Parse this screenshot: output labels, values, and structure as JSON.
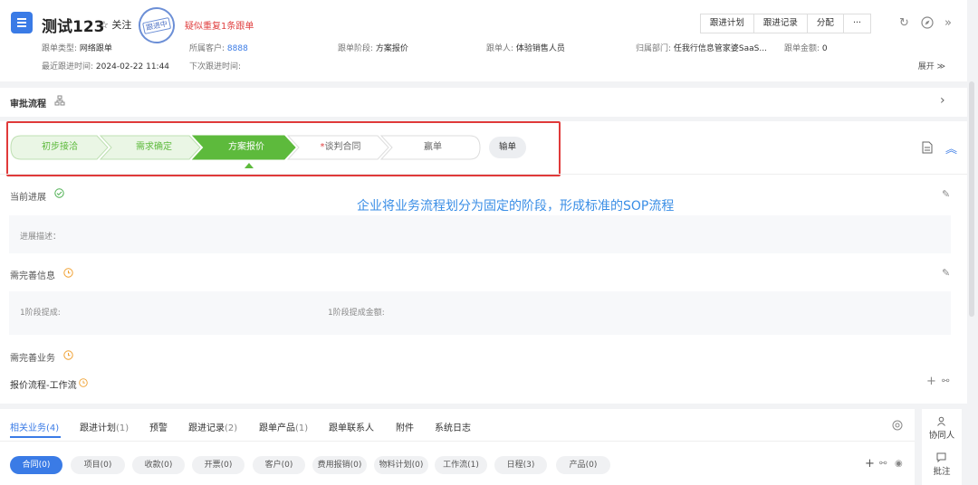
{
  "header": {
    "title": "测试123",
    "follow_label": "☆ 关注",
    "stamp": "跟进中",
    "duplicate_warning": "疑似重复1条跟单",
    "meta": {
      "type_label": "跟单类型:",
      "type_value": "网络跟单",
      "customer_label": "所属客户:",
      "customer_value": "8888",
      "stage_label": "跟单阶段:",
      "stage_value": "方案报价",
      "owner_label": "跟单人:",
      "owner_value": "体验销售人员",
      "dept_label": "归属部门:",
      "dept_value": "任我行信息管家婆SaaS...",
      "amount_label": "跟单金额:",
      "amount_value": "0",
      "last_label": "最近跟进时间:",
      "last_value": "2024-02-22 11:44",
      "next_label": "下次跟进时间:"
    },
    "buttons": [
      "跟进计划",
      "跟进记录",
      "分配",
      "···"
    ],
    "expand_label": "展开 ≫"
  },
  "approval": {
    "title": "审批流程"
  },
  "stages": {
    "items": [
      "初步接洽",
      "需求确定",
      "方案报价",
      "谈判合同",
      "赢单"
    ],
    "required_mark": "*",
    "lose_button": "输单",
    "annotation": "企业将业务流程划分为固定的阶段，形成标准的SOP流程"
  },
  "progress": {
    "title": "当前进展",
    "desc_label": "进展描述："
  },
  "info": {
    "title": "需完善信息",
    "field1": "1阶段提成:",
    "field2": "1阶段提成金额:"
  },
  "business": {
    "title": "需完善业务",
    "workflow": "报价流程-工作流"
  },
  "tabs": {
    "items": [
      {
        "label": "相关业务",
        "count": "(4)"
      },
      {
        "label": "跟进计划",
        "count": "(1)"
      },
      {
        "label": "预警",
        "count": ""
      },
      {
        "label": "跟进记录",
        "count": "(2)"
      },
      {
        "label": "跟单产品",
        "count": "(1)"
      },
      {
        "label": "跟单联系人",
        "count": ""
      },
      {
        "label": "附件",
        "count": ""
      },
      {
        "label": "系统日志",
        "count": ""
      }
    ],
    "pills": [
      "合同(0)",
      "项目(0)",
      "收款(0)",
      "开票(0)",
      "客户(0)",
      "费用报销(0)",
      "物料计划(0)",
      "工作流(1)",
      "日程(3)",
      "产品(0)"
    ]
  },
  "side": {
    "collab": "协同人",
    "note": "批注"
  },
  "colors": {
    "accent": "#3a7be6",
    "stage_done": "#e9f6e4",
    "stage_active": "#5dba3c",
    "warning": "#e04040"
  }
}
